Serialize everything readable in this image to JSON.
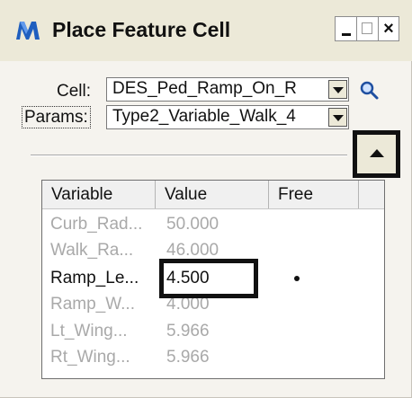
{
  "window": {
    "title": "Place Feature Cell",
    "icon": "bentley-m-icon",
    "close_glyph": "×",
    "colors": {
      "accent_icon": "#1f5fbf",
      "disabled_text": "#a9a9a9"
    }
  },
  "form": {
    "cell_label": "Cell:",
    "cell_value": "DES_Ped_Ramp_On_R",
    "params_label": "Params:",
    "params_value": "Type2_Variable_Walk_4"
  },
  "table": {
    "columns": [
      "Variable",
      "Value",
      "Free"
    ],
    "rows": [
      {
        "variable": "Curb_Rad...",
        "value": "50.000",
        "free": false,
        "enabled": false
      },
      {
        "variable": "Walk_Ra...",
        "value": "46.000",
        "free": false,
        "enabled": false
      },
      {
        "variable": "Ramp_Le...",
        "value": "4.500",
        "free": true,
        "enabled": true
      },
      {
        "variable": "Ramp_W...",
        "value": "4.000",
        "free": false,
        "enabled": false
      },
      {
        "variable": "Lt_Wing...",
        "value": "5.966",
        "free": false,
        "enabled": false
      },
      {
        "variable": "Rt_Wing...",
        "value": "5.966",
        "free": false,
        "enabled": false
      }
    ]
  }
}
